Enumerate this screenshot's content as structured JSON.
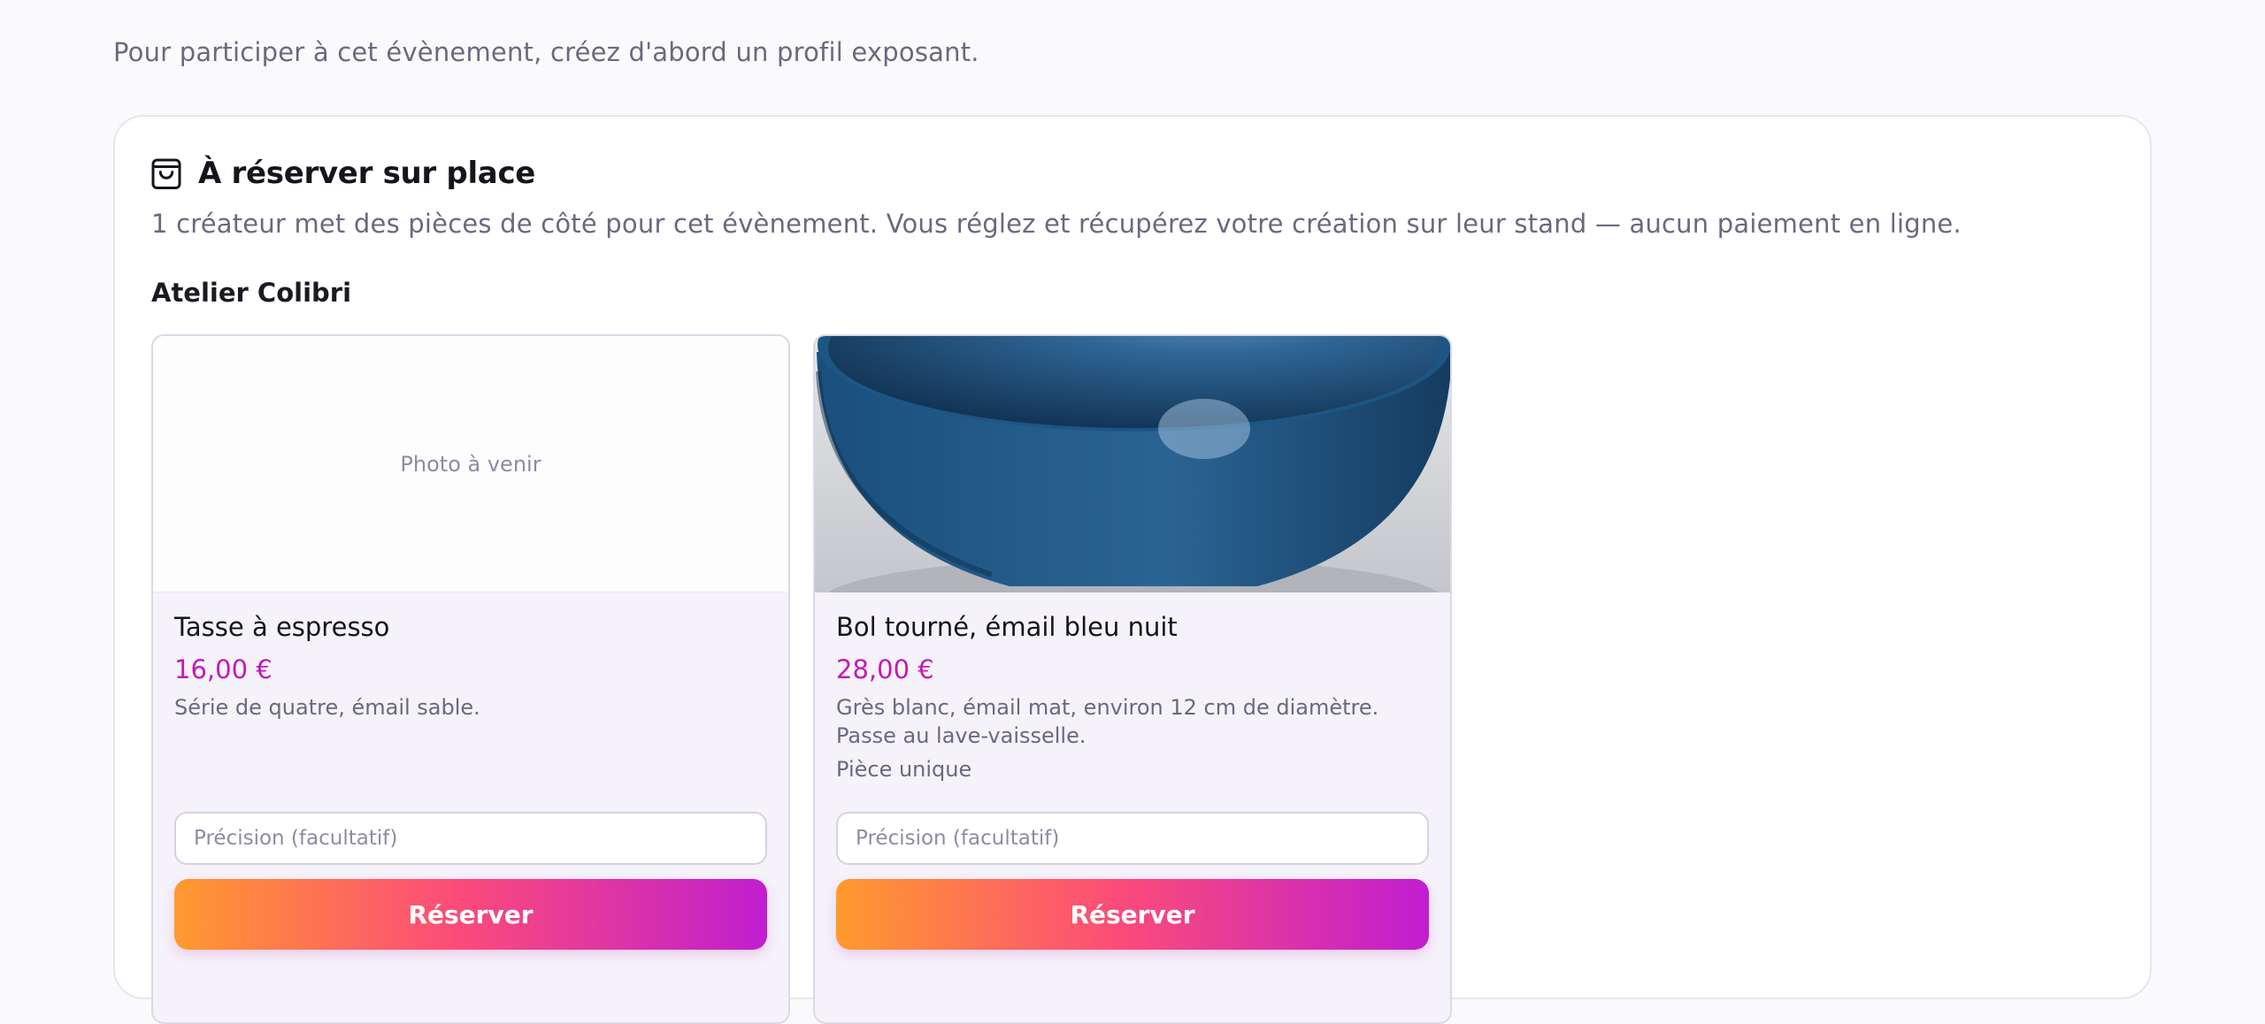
{
  "intro": "Pour participer à cet évènement, créez d'abord un profil exposant.",
  "panel": {
    "icon": "shopping-bag-icon",
    "title": "À réserver sur place",
    "description": "1 créateur met des pièces de côté pour cet évènement. Vous réglez et récupérez votre création sur leur stand — aucun paiement en ligne.",
    "creator": "Atelier Colibri"
  },
  "products": [
    {
      "photo_placeholder": "Photo à venir",
      "name": "Tasse à espresso",
      "price": "16,00 €",
      "description": "Série de quatre, émail sable.",
      "precision_placeholder": "Précision (facultatif)",
      "button": "Réserver"
    },
    {
      "photo": "blue-ceramic-bowl-photo",
      "name": "Bol tourné, émail bleu nuit",
      "price": "28,00 €",
      "description": "Grès blanc, émail mat, environ 12 cm de diamètre. Passe au lave-vaisselle.",
      "unique": "Pièce unique",
      "precision_placeholder": "Précision (facultatif)",
      "button": "Réserver"
    }
  ],
  "colors": {
    "accent_price": "#c21ab6",
    "gradient_start": "#ff9a2e",
    "gradient_mid": "#fb4b7a",
    "gradient_end": "#c01ed0",
    "bowl_glaze": "#1f4f78"
  }
}
